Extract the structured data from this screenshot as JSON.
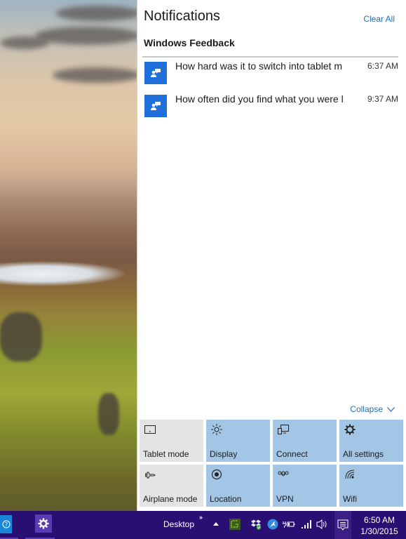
{
  "action_center": {
    "title": "Notifications",
    "clear_all_label": "Clear All",
    "groups": [
      {
        "app_name": "Windows Feedback",
        "app_icon": "feedback-icon",
        "accent_color": "#1e6fd9",
        "notifications": [
          {
            "message": "How hard was it to switch into tablet m",
            "time": "6:37 AM"
          },
          {
            "message": "How often did you find what you were l",
            "time": "9:37 AM"
          }
        ]
      }
    ],
    "collapse_label": "Collapse",
    "quick_actions": [
      {
        "label": "Tablet mode",
        "icon": "tablet-mode-icon",
        "active": false
      },
      {
        "label": "Display",
        "icon": "brightness-icon",
        "active": true
      },
      {
        "label": "Connect",
        "icon": "connect-icon",
        "active": true
      },
      {
        "label": "All settings",
        "icon": "gear-icon",
        "active": true
      },
      {
        "label": "Airplane mode",
        "icon": "airplane-icon",
        "active": false
      },
      {
        "label": "Location",
        "icon": "location-icon",
        "active": true
      },
      {
        "label": "VPN",
        "icon": "vpn-icon",
        "active": true
      },
      {
        "label": "Wifi",
        "icon": "wifi-icon",
        "active": true
      }
    ]
  },
  "taskbar": {
    "desktop_label": "Desktop",
    "toolbar_overflow": "»",
    "clock_time": "6:50 AM",
    "clock_date": "1/30/2015",
    "tray_icons": [
      "show-hidden-icons",
      "app-green-icon",
      "dropbox-icon",
      "kangaroo-app-icon",
      "battery-icon",
      "signal-icon",
      "volume-icon"
    ],
    "colors": {
      "background": "#2a0f73",
      "accent": "#5a3bb4"
    }
  }
}
